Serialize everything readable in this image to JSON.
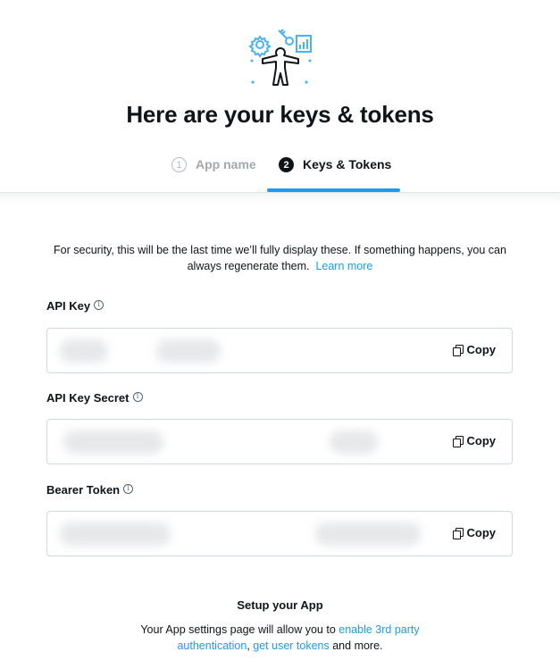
{
  "header": {
    "title": "Here are your keys & tokens",
    "illustration": "developer-keys-illustration"
  },
  "stepper": {
    "steps": [
      {
        "number": "1",
        "label": "App name",
        "state": "completed-inactive"
      },
      {
        "number": "2",
        "label": "Keys & Tokens",
        "state": "active"
      }
    ],
    "active_color": "#1d9bf0"
  },
  "notice": {
    "text": "For security, this will be the last time we’ll fully display these. If something happens, you can always regenerate them.",
    "link_label": "Learn more"
  },
  "fields": [
    {
      "label": "API Key",
      "info_icon": "info-icon",
      "value": "[redacted]",
      "copy_label": "Copy",
      "copy_icon": "copy-icon"
    },
    {
      "label": "API Key Secret",
      "info_icon": "info-icon",
      "value": "[redacted]",
      "copy_label": "Copy",
      "copy_icon": "copy-icon"
    },
    {
      "label": "Bearer Token",
      "info_icon": "info-icon",
      "value": "[redacted]",
      "copy_label": "Copy",
      "copy_icon": "copy-icon"
    }
  ],
  "setup": {
    "title": "Setup your App",
    "text_before": "Your App settings page will allow you to",
    "link1": "enable 3rd party authentication",
    "separator": ",",
    "link2": "get user tokens",
    "text_after": "and more."
  },
  "colors": {
    "accent": "#1d9bf0",
    "text": "#0f1419",
    "muted": "#a0a8b0",
    "border": "#cfd9de"
  }
}
